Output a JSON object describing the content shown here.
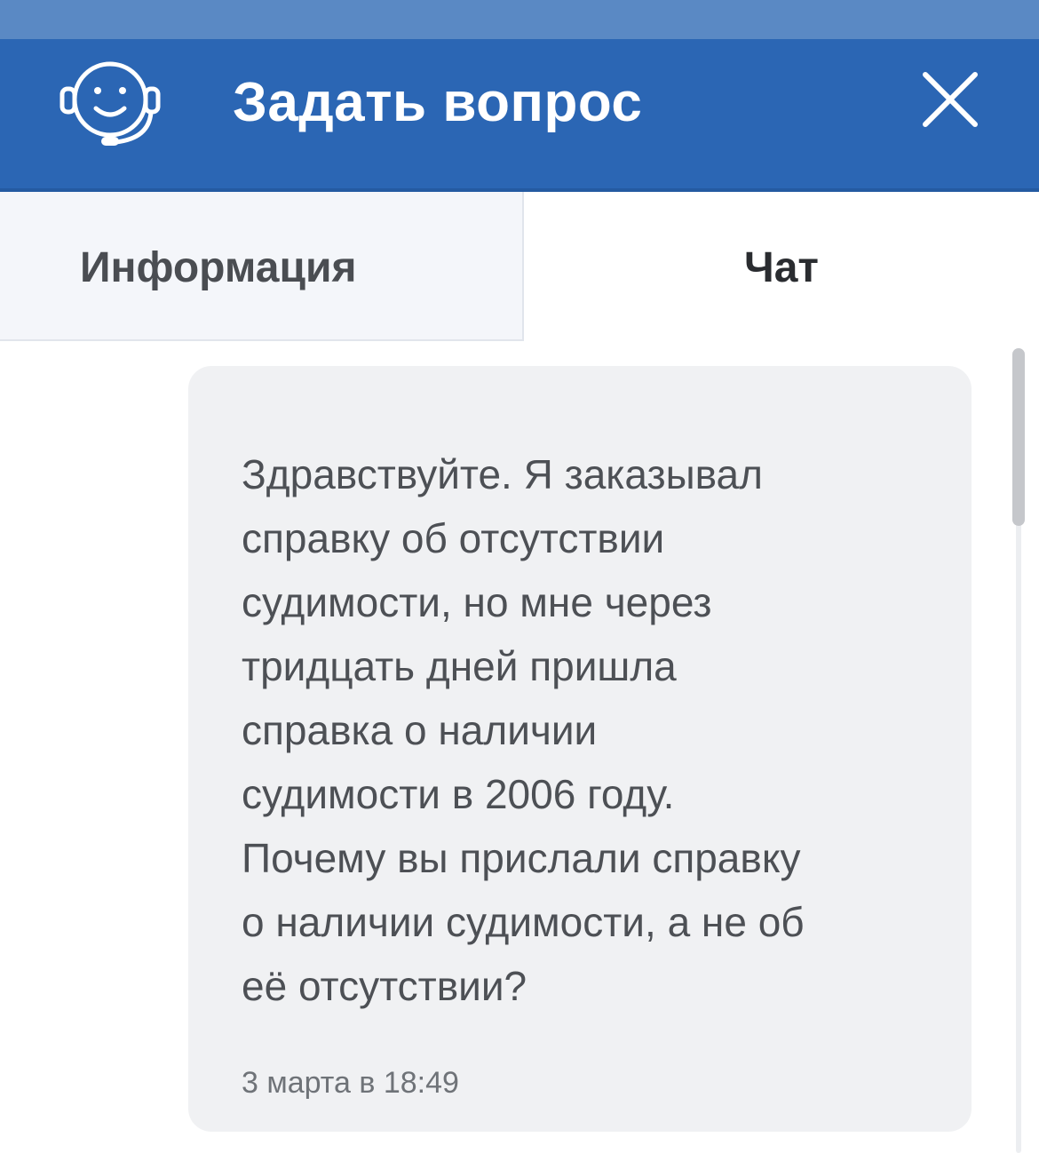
{
  "header": {
    "title": "Задать вопрос",
    "icon": "support-headset-icon",
    "close_icon": "close-icon",
    "background_color": "#2b66b4"
  },
  "tabs": [
    {
      "label": "Информация",
      "active": false
    },
    {
      "label": "Чат",
      "active": true
    }
  ],
  "chat": {
    "messages": [
      {
        "text": "Здравствуйте. Я заказывал\nсправку об отсутствии\nсудимости, но мне через\nтридцать дней пришла\nсправка о наличии\nсудимости в 2006 году.\nПочему вы прислали справку\nо наличии судимости, а не об\neё отсутствии?",
        "time": "3 марта в 18:49"
      }
    ]
  }
}
